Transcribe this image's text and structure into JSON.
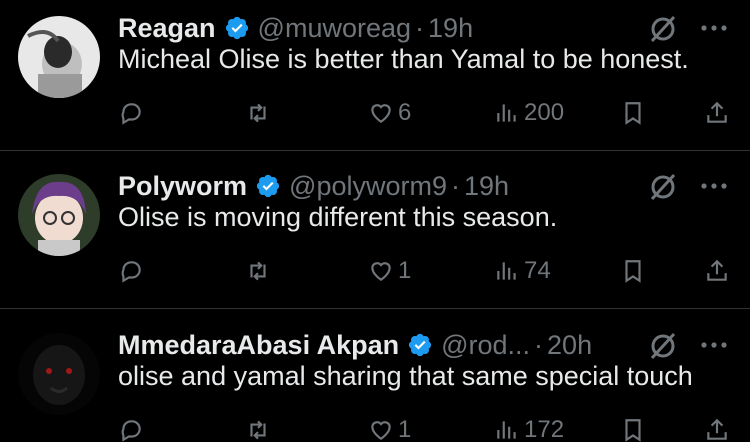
{
  "tweets": [
    {
      "name": "Reagan",
      "handle": "@muworeag",
      "separator": "·",
      "time": "19h",
      "text": "Micheal Olise is better than Yamal to be honest.",
      "replies": "",
      "retweets": "",
      "likes": "6",
      "views": "200"
    },
    {
      "name": "Polyworm",
      "handle": "@polyworm9",
      "separator": "·",
      "time": "19h",
      "text": "Olise is moving different this season.",
      "replies": "",
      "retweets": "",
      "likes": "1",
      "views": "74"
    },
    {
      "name": "MmedaraAbasi Akpan",
      "handle": "@rod...",
      "separator": "·",
      "time": "20h",
      "text": "olise and yamal sharing that same special touch",
      "replies": "",
      "retweets": "",
      "likes": "1",
      "views": "172"
    }
  ],
  "colors": {
    "background": "#000000",
    "text_primary": "#e7e9ea",
    "text_secondary": "#71767b",
    "verified_blue": "#1d9bf0",
    "divider": "#2f3336"
  },
  "icons": [
    "verified-badge-icon",
    "grok-icon",
    "more-icon",
    "reply-icon",
    "retweet-icon",
    "like-icon",
    "views-icon",
    "bookmark-icon",
    "share-icon"
  ]
}
